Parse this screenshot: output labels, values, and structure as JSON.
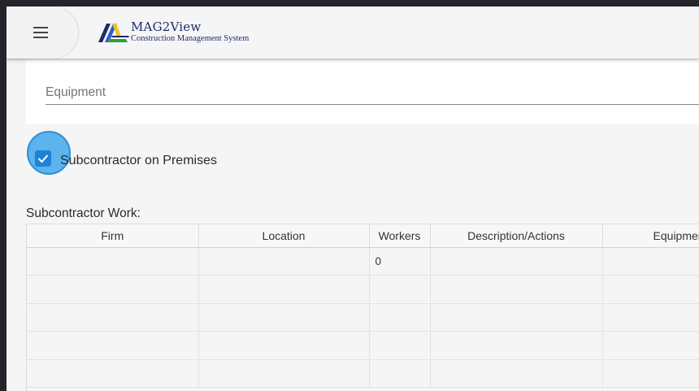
{
  "header": {
    "menu_icon": "hamburger-icon",
    "logo_title": "MAG2View",
    "logo_subtitle": "Construction Management System",
    "brand_colors": {
      "navy": "#1f2a6b",
      "green": "#2e9e3c",
      "yellow": "#f2c318",
      "blue": "#2b5fd0"
    }
  },
  "equipment_field": {
    "label": "Equipment"
  },
  "subcontractor_checkbox": {
    "label": "Subcontractor on Premises",
    "checked": true,
    "accent": "#1f82d6"
  },
  "subcontractor_section": {
    "title": "Subcontractor Work:",
    "columns": [
      "Firm",
      "Location",
      "Workers",
      "Description/Actions",
      "Equipment"
    ],
    "rows": [
      [
        "",
        "",
        "0",
        "",
        ""
      ],
      [
        "",
        "",
        "",
        "",
        ""
      ],
      [
        "",
        "",
        "",
        "",
        ""
      ],
      [
        "",
        "",
        "",
        "",
        ""
      ],
      [
        "",
        "",
        "",
        "",
        ""
      ]
    ]
  }
}
